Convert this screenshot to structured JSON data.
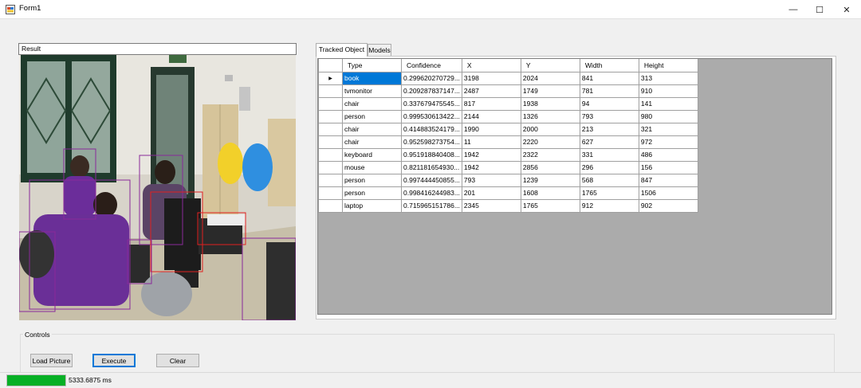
{
  "window": {
    "title": "Form1",
    "minimize_glyph": "—",
    "maximize_glyph": "☐",
    "close_glyph": "✕"
  },
  "result_label": "Result",
  "tabs": [
    {
      "label": "Tracked Object",
      "active": true
    },
    {
      "label": "Models",
      "active": false
    }
  ],
  "grid": {
    "columns": [
      "Type",
      "Confidence",
      "X",
      "Y",
      "Width",
      "Height"
    ],
    "current_row_marker": "▶",
    "rows": [
      [
        "book",
        "0.299620270729...",
        "3198",
        "2024",
        "841",
        "313"
      ],
      [
        "tvmonitor",
        "0.209287837147...",
        "2487",
        "1749",
        "781",
        "910"
      ],
      [
        "chair",
        "0.337679475545...",
        "817",
        "1938",
        "94",
        "141"
      ],
      [
        "person",
        "0.999530613422...",
        "2144",
        "1326",
        "793",
        "980"
      ],
      [
        "chair",
        "0.414883524179...",
        "1990",
        "2000",
        "213",
        "321"
      ],
      [
        "chair",
        "0.952598273754...",
        "11",
        "2220",
        "627",
        "972"
      ],
      [
        "keyboard",
        "0.951918840408...",
        "1942",
        "2322",
        "331",
        "486"
      ],
      [
        "mouse",
        "0.821181654930...",
        "1942",
        "2856",
        "296",
        "156"
      ],
      [
        "person",
        "0.997444450855...",
        "793",
        "1239",
        "568",
        "847"
      ],
      [
        "person",
        "0.998416244983...",
        "201",
        "1608",
        "1765",
        "1506"
      ],
      [
        "laptop",
        "0.715965151786...",
        "2345",
        "1765",
        "912",
        "902"
      ]
    ]
  },
  "controls": {
    "group_label": "Controls",
    "load_picture": "Load Picture",
    "execute": "Execute",
    "clear": "Clear"
  },
  "status": {
    "progress_fraction": 1.0,
    "elapsed": "5333.6875 ms"
  },
  "colors": {
    "selection": "#0078d7",
    "progress": "#06b025",
    "box_purple": "#8a2a9a",
    "box_red": "#e02020"
  }
}
